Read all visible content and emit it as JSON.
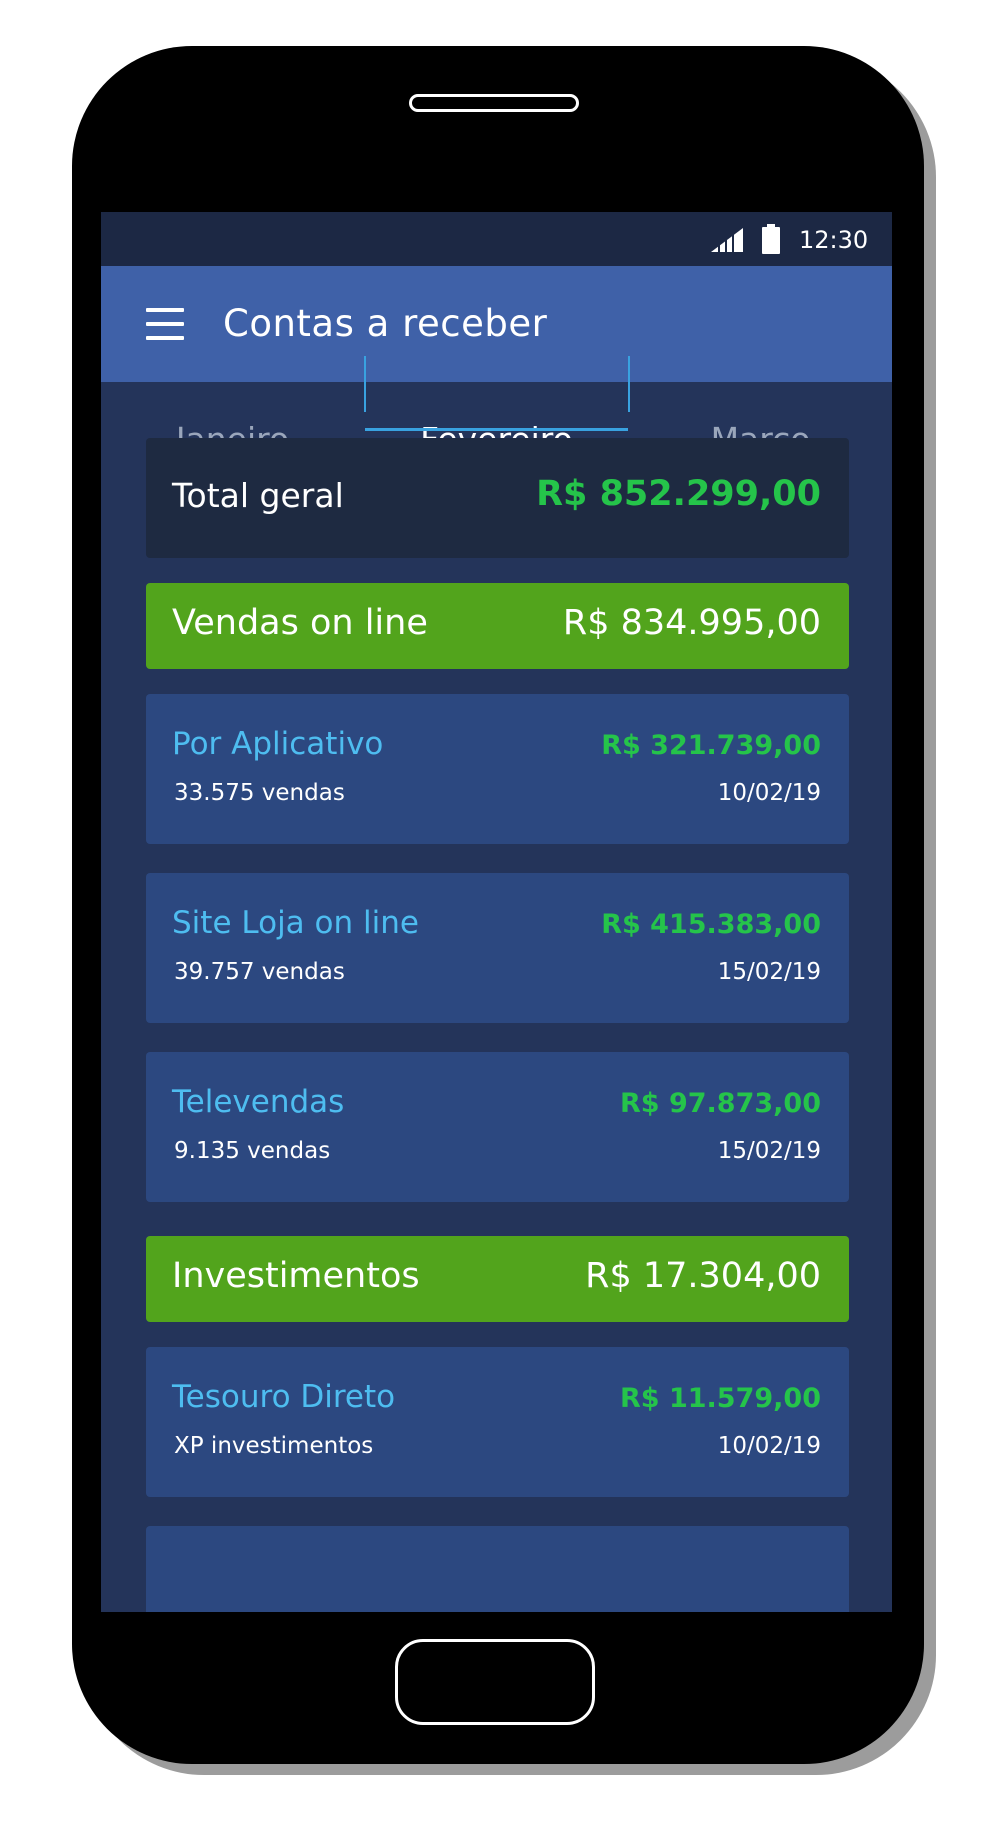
{
  "status_bar": {
    "time": "12:30"
  },
  "app_bar": {
    "title": "Contas a receber"
  },
  "tabs": [
    {
      "label": "Janeiro",
      "active": false
    },
    {
      "label": "Fevereiro",
      "active": true
    },
    {
      "label": "Março",
      "active": false
    }
  ],
  "total": {
    "label": "Total geral",
    "value": "R$ 852.299,00"
  },
  "groups": [
    {
      "label": "Vendas on line",
      "value": "R$ 834.995,00",
      "items": [
        {
          "name": "Por Aplicativo",
          "sub": "33.575 vendas",
          "amount": "R$ 321.739,00",
          "date": "10/02/19"
        },
        {
          "name": "Site Loja on line",
          "sub": "39.757 vendas",
          "amount": "R$ 415.383,00",
          "date": "15/02/19"
        },
        {
          "name": "Televendas",
          "sub": "9.135 vendas",
          "amount": "R$ 97.873,00",
          "date": "15/02/19"
        }
      ]
    },
    {
      "label": "Investimentos",
      "value": "R$ 17.304,00",
      "items": [
        {
          "name": "Tesouro Direto",
          "sub": "XP investimentos",
          "amount": "R$ 11.579,00",
          "date": "10/02/19"
        }
      ]
    }
  ],
  "colors": {
    "app_bar": "#3f61a8",
    "screen_bg": "#24345a",
    "group_bar": "#52a41c",
    "amount_green": "#25c44a",
    "item_name_blue": "#4ebdf0",
    "tab_indicator": "#39a2e0"
  },
  "icons": [
    "menu-icon",
    "signal-icon",
    "battery-icon"
  ]
}
